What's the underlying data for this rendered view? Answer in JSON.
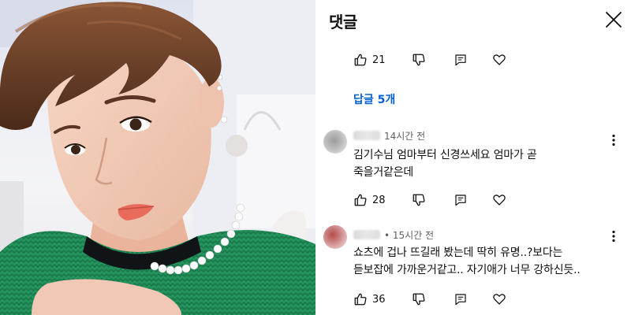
{
  "panel": {
    "title": "댓글"
  },
  "first_comment_actions": {
    "like_count": "21"
  },
  "replies_link": "답글 5개",
  "comments": [
    {
      "time": "14시간 전",
      "text_line1": "김기수님 엄마부터 신경쓰세요 엄마가 곧",
      "text_line2": "죽을거같은데",
      "like_count": "28"
    },
    {
      "time": "• 15시간 전",
      "text_line1": "쇼츠에 겁나 뜨길래 봤는데 딱히 유명..?보다는",
      "text_line2": "듣보잡에 가까운거같고.. 자기애가 너무 강하신듯..",
      "like_count": "36"
    }
  ],
  "colors": {
    "link_blue": "#065fd4",
    "meta_gray": "#606060",
    "text": "#0f0f0f",
    "sweater_green": "#1f8a55"
  },
  "icons": [
    "thumbs-up-icon",
    "thumbs-down-icon",
    "reply-icon",
    "heart-icon",
    "close-icon",
    "more-vertical-icon"
  ]
}
